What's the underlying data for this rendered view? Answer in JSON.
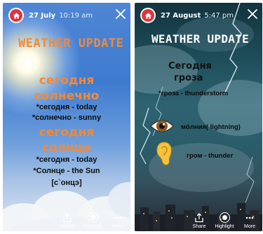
{
  "left_story": {
    "date": "27 July",
    "time": "10:19 am",
    "title": "WEATHER UPDATE",
    "heading1_line1": "сегодня",
    "heading1_line2": "солнечно",
    "line1": "*сегодня - today",
    "line2": "*солнечно - sunny",
    "heading2_line1": "сегодня",
    "heading2_line2": "солнце",
    "line3": "*сегодня - today",
    "line4": "*Солнце - the Sun",
    "line5": "[с`онцэ]"
  },
  "right_story": {
    "date": "27 August",
    "time": "5:47 pm",
    "title": "WEATHER UPDATE",
    "heading_line1": "Сегодня",
    "heading_line2": "гроза",
    "line1": "*гроза - thunderstorm",
    "line2": "мо́лния( lightning)",
    "line3": "гром - thunder"
  },
  "bottom_bar": {
    "share_label": "Share",
    "highlight_label": "Highlight",
    "more_label": "More"
  },
  "colors": {
    "accent_orange": "#f08a3a",
    "avatar_red": "#d9363e"
  },
  "icons": {
    "avatar": "home-icon",
    "close": "close-icon",
    "share": "share-icon",
    "highlight": "highlight-icon",
    "more": "more-icon",
    "eye": "eye-emoji",
    "ear": "ear-emoji"
  }
}
